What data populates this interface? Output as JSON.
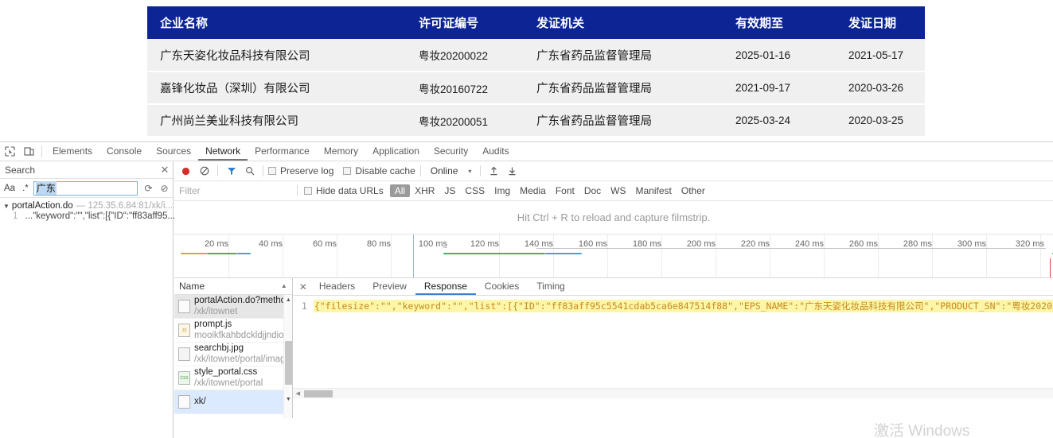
{
  "page": {
    "table": {
      "columns": [
        "企业名称",
        "许可证编号",
        "发证机关",
        "有效期至",
        "发证日期"
      ],
      "rows": [
        {
          "name": "广东天姿化妆品科技有限公司",
          "license_no": "粤妆20200022",
          "authority": "广东省药品监督管理局",
          "valid_until": "2025-01-16",
          "issue_date": "2021-05-17"
        },
        {
          "name": "嘉锋化妆品（深圳）有限公司",
          "license_no": "粤妆20160722",
          "authority": "广东省药品监督管理局",
          "valid_until": "2021-09-17",
          "issue_date": "2020-03-26"
        },
        {
          "name": "广州尚兰美业科技有限公司",
          "license_no": "粤妆20200051",
          "authority": "广东省药品监督管理局",
          "valid_until": "2025-03-24",
          "issue_date": "2020-03-25"
        }
      ]
    },
    "header_bg": "#0c2494"
  },
  "devtools": {
    "tabs": [
      {
        "label": "Elements",
        "active": false
      },
      {
        "label": "Console",
        "active": false
      },
      {
        "label": "Sources",
        "active": false
      },
      {
        "label": "Network",
        "active": true
      },
      {
        "label": "Performance",
        "active": false
      },
      {
        "label": "Memory",
        "active": false
      },
      {
        "label": "Application",
        "active": false
      },
      {
        "label": "Security",
        "active": false
      },
      {
        "label": "Audits",
        "active": false
      }
    ],
    "search": {
      "title": "Search",
      "close_label": "✕",
      "match_case_label": "Aa",
      "regex_label": ".*",
      "query": "广东",
      "refresh_label": "⟳",
      "clear_label": "⊘",
      "result": {
        "file": "portalAction.do",
        "dash": "—",
        "url": "125.35.6.84:81/xk/i...",
        "line_no": "1",
        "snippet": "...\"keyword\":\"\",\"list\":[{\"ID\":\"ff83aff95..."
      }
    },
    "network": {
      "toolbar": {
        "record_label": "●",
        "clear_label": "⊘",
        "filter_label": "▼",
        "search_label": "⌕",
        "preserve_log": "Preserve log",
        "disable_cache": "Disable cache",
        "throttling": "Online",
        "caret": "▾",
        "import_label": "⬆",
        "export_label": "⬇"
      },
      "filterbar": {
        "filter_placeholder": "Filter",
        "hide_data_urls": "Hide data URLs",
        "types": [
          "All",
          "XHR",
          "JS",
          "CSS",
          "Img",
          "Media",
          "Font",
          "Doc",
          "WS",
          "Manifest",
          "Other"
        ],
        "active_type": "All"
      },
      "filmstrip_hint": "Hit Ctrl + R to reload and capture filmstrip.",
      "timeline": {
        "ticks": [
          "20 ms",
          "40 ms",
          "60 ms",
          "80 ms",
          "100 ms",
          "120 ms",
          "140 ms",
          "160 ms",
          "180 ms",
          "200 ms",
          "220 ms",
          "240 ms",
          "260 ms",
          "280 ms",
          "300 ms",
          "320 ms"
        ]
      },
      "list": {
        "header": "Name",
        "sort_caret": "▲",
        "rows": [
          {
            "name": "portalAction.do?metho..",
            "sub": "/xk/itownet",
            "kind": "doc",
            "state": "selected"
          },
          {
            "name": "prompt.js",
            "sub": "mooikfkahbdckldjjndioa",
            "kind": "js",
            "state": ""
          },
          {
            "name": "searchbj.jpg",
            "sub": "/xk/itownet/portal/imag",
            "kind": "img",
            "state": ""
          },
          {
            "name": "style_portal.css",
            "sub": "/xk/itownet/portal",
            "kind": "css",
            "state": ""
          },
          {
            "name": "xk/",
            "sub": "",
            "kind": "doc",
            "state": "highlight"
          }
        ]
      },
      "detail": {
        "close_label": "✕",
        "tabs": [
          {
            "label": "Headers",
            "active": false
          },
          {
            "label": "Preview",
            "active": false
          },
          {
            "label": "Response",
            "active": true
          },
          {
            "label": "Cookies",
            "active": false
          },
          {
            "label": "Timing",
            "active": false
          }
        ],
        "response": {
          "line_no": "1",
          "body": "{\"filesize\":\"\",\"keyword\":\"\",\"list\":[{\"ID\":\"ff83aff95c5541cdab5ca6e847514f88\",\"EPS_NAME\":\"广东天姿化妆品科技有限公司\",\"PRODUCT_SN\":\"粤妆2020"
        }
      }
    }
  },
  "watermark": "激活 Windows"
}
